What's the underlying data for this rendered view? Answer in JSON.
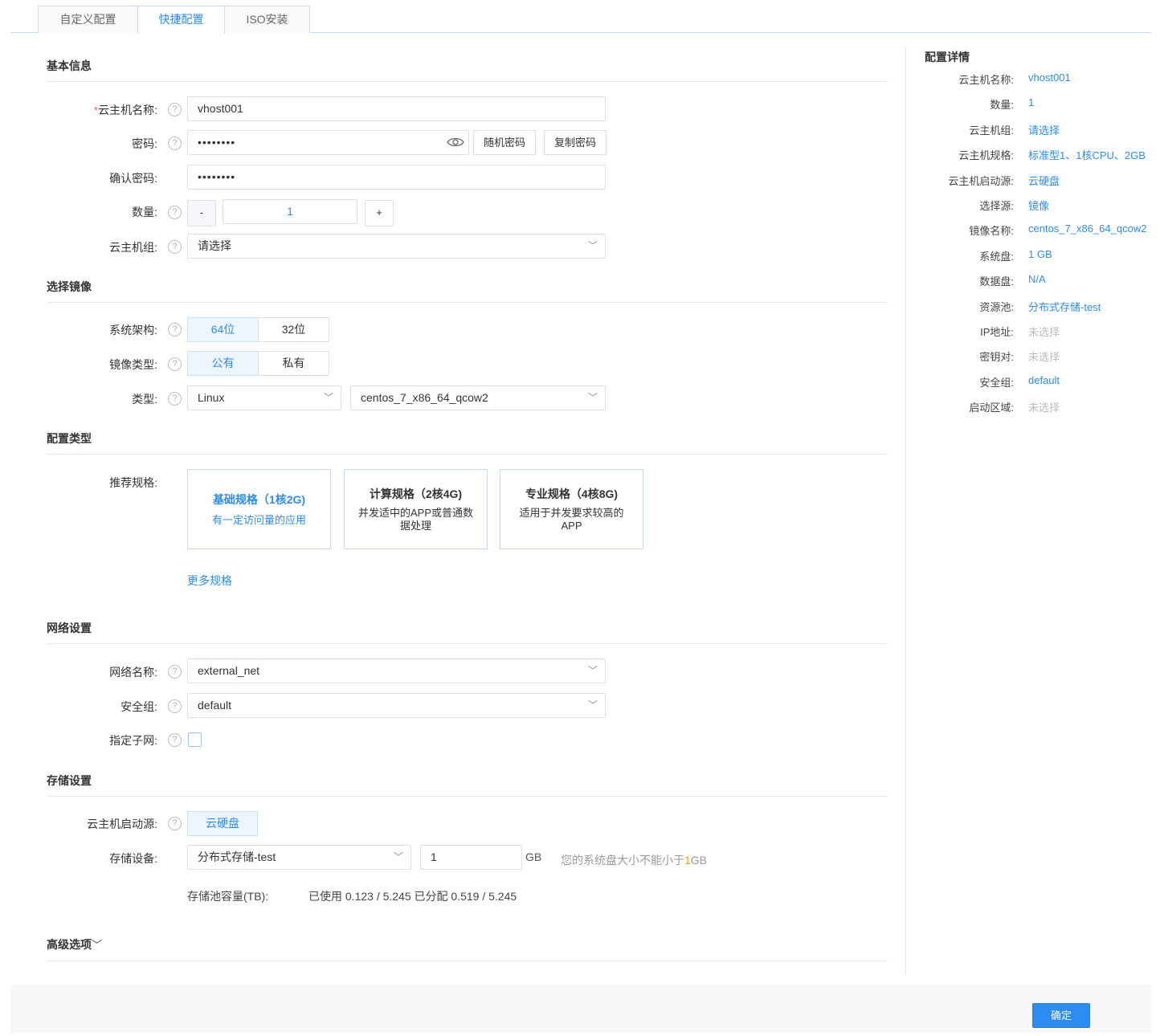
{
  "tabs": [
    {
      "label": "自定义配置"
    },
    {
      "label": "快捷配置"
    },
    {
      "label": "ISO安装"
    }
  ],
  "sections": {
    "basic": "基本信息",
    "image": "选择镜像",
    "config_type": "配置类型",
    "network": "网络设置",
    "storage": "存储设置",
    "advanced": "高级选项"
  },
  "advanced_chevron": "﹀",
  "help_glyph": "?",
  "required_mark": "*",
  "form": {
    "name": {
      "label": "云主机名称:",
      "value": "vhost001"
    },
    "password": {
      "label": "密码:",
      "value": "••••••••",
      "random_btn": "随机密码",
      "copy_btn": "复制密码"
    },
    "confirm": {
      "label": "确认密码:",
      "value": "••••••••"
    },
    "quantity": {
      "label": "数量:",
      "value": "1",
      "minus": "-",
      "plus": "+"
    },
    "group": {
      "label": "云主机组:",
      "value": "请选择"
    },
    "arch": {
      "label": "系统架构:",
      "options": [
        "64位",
        "32位"
      ],
      "selected": "64位"
    },
    "image_type": {
      "label": "镜像类型:",
      "options": [
        "公有",
        "私有"
      ],
      "selected": "公有"
    },
    "type": {
      "label": "类型:",
      "os": "Linux",
      "image": "centos_7_x86_64_qcow2"
    },
    "spec": {
      "label": "推荐规格:",
      "cards": [
        {
          "title": "基础规格（1核2G)",
          "desc": "有一定访问量的应用"
        },
        {
          "title": "计算规格（2核4G)",
          "desc": "并发适中的APP或普通数据处理"
        },
        {
          "title": "专业规格（4核8G)",
          "desc": "适用于并发要求较高的APP"
        }
      ],
      "more": "更多规格"
    },
    "net_name": {
      "label": "网络名称:",
      "value": "external_net"
    },
    "sec_group": {
      "label": "安全组:",
      "value": "default"
    },
    "subnet": {
      "label": "指定子网:",
      "checked": false
    },
    "boot_source": {
      "label": "云主机启动源:",
      "value": "云硬盘"
    },
    "storage_device": {
      "label": "存储设备:",
      "value": "分布式存储-test",
      "size": "1",
      "unit": "GB",
      "hint_prefix": "您的系统盘大小不能小于",
      "hint_num": "1",
      "hint_suffix": "GB"
    },
    "pool": {
      "label": "存储池容量(TB):",
      "value": "已使用 0.123 / 5.245 已分配 0.519 / 5.245"
    }
  },
  "detail": {
    "title": "配置详情",
    "rows": [
      {
        "k": "云主机名称:",
        "v": "vhost001",
        "muted": false
      },
      {
        "k": "数量:",
        "v": "1",
        "muted": false
      },
      {
        "k": "云主机组:",
        "v": "请选择",
        "muted": false
      },
      {
        "k": "云主机规格:",
        "v": "标准型1、1核CPU、2GB",
        "muted": false
      },
      {
        "k": "云主机启动源:",
        "v": "云硬盘",
        "muted": false
      },
      {
        "k": "选择源:",
        "v": "镜像",
        "muted": false
      },
      {
        "k": "镜像名称:",
        "v": "centos_7_x86_64_qcow2",
        "muted": false
      },
      {
        "k": "系统盘:",
        "v": "1 GB",
        "muted": false
      },
      {
        "k": "数据盘:",
        "v": "N/A",
        "muted": false
      },
      {
        "k": "资源池:",
        "v": "分布式存储-test",
        "muted": false
      },
      {
        "k": "IP地址:",
        "v": "未选择",
        "muted": true
      },
      {
        "k": "密钥对:",
        "v": "未选择",
        "muted": true
      },
      {
        "k": "安全组:",
        "v": "default",
        "muted": false
      },
      {
        "k": "启动区域:",
        "v": "未选择",
        "muted": true
      }
    ]
  },
  "footer": {
    "confirm": "确定"
  },
  "colors": {
    "accent": "#2d8cf0",
    "warn": "#f39c12"
  }
}
